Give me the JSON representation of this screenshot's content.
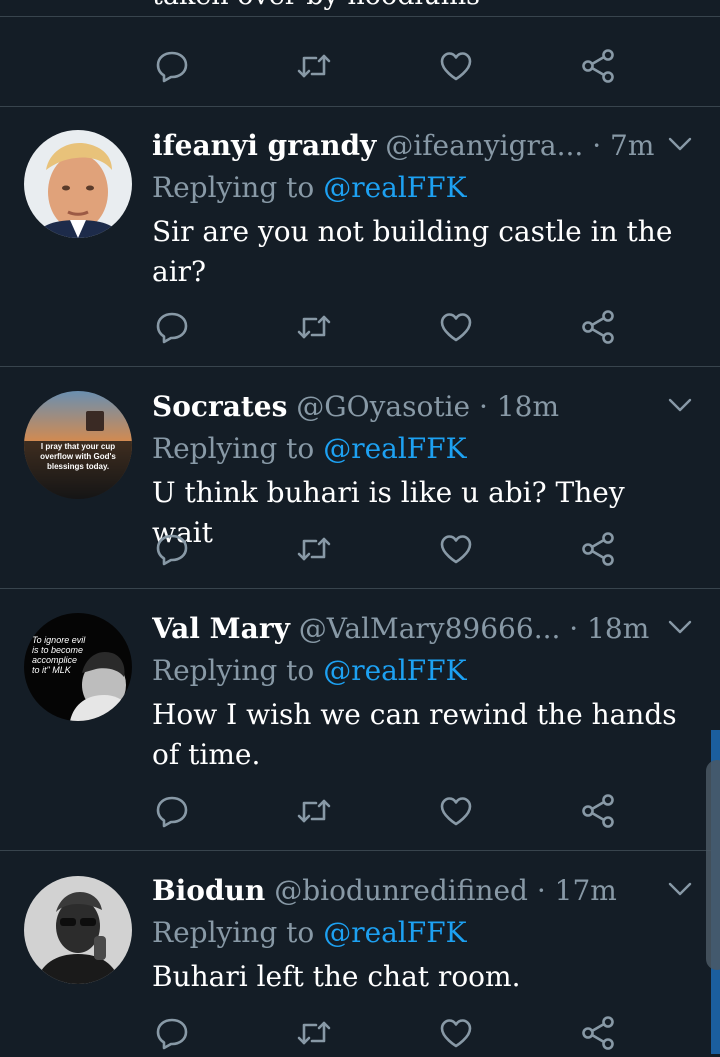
{
  "colors": {
    "background": "#141d26",
    "divider": "#38444d",
    "muted": "#8899a6",
    "accent": "#1da1f2",
    "text": "#ffffff"
  },
  "cut_tweet": {
    "text_fragment": "taken over by hoodlums"
  },
  "action_icons": [
    "reply-icon",
    "retweet-icon",
    "like-icon",
    "share-icon"
  ],
  "tweets": [
    {
      "name": "ifeanyi grandy",
      "handle": "@ifeanyigra...",
      "time": "· 7m",
      "replying_label": "Replying to",
      "mention": "@realFFK",
      "text": "Sir are you not building castle in the air?"
    },
    {
      "name": "Socrates",
      "handle": "@GOyasotie",
      "time": "· 18m",
      "replying_label": "Replying to",
      "mention": "@realFFK",
      "text": "U think buhari is like u abi? They wait",
      "avatar_text": "I pray that your cup overflow with God's blessings today."
    },
    {
      "name": "Val Mary",
      "handle": "@ValMary89666...",
      "time": "· 18m",
      "replying_label": "Replying to",
      "mention": "@realFFK",
      "text": "How I wish we can rewind the hands of time.",
      "avatar_text": "To ignore evil is to become accomplice to it\" MLK"
    },
    {
      "name": "Biodun",
      "handle": "@biodunredifined",
      "time": "· 17m",
      "replying_label": "Replying to",
      "mention": "@realFFK",
      "text": "Buhari left the chat room."
    }
  ]
}
